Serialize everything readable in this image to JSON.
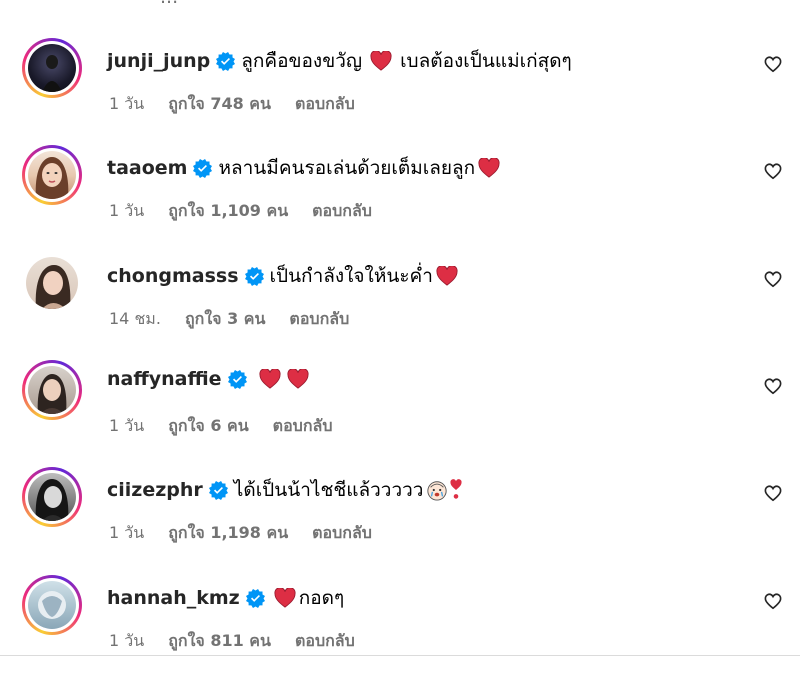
{
  "cut_off_text": "...",
  "comments": [
    {
      "username": "junji_junp",
      "text": "ลูกคือของขวัญ",
      "suffix": "เบลต้องเป็นแม่เก่สุดๆ",
      "time": "1 วัน",
      "likes": "ถูกใจ 748 คน",
      "reply": "ตอบกลับ",
      "ring": true
    },
    {
      "username": "taaoem",
      "text": "หลานมีคนรอเล่นด้วยเต็มเลยลูก",
      "suffix": "",
      "time": "1 วัน",
      "likes": "ถูกใจ 1,109 คน",
      "reply": "ตอบกลับ",
      "ring": true
    },
    {
      "username": "chongmasss",
      "text": "เป็นกำลังใจให้นะค่ำ",
      "suffix": "",
      "time": "14 ชม.",
      "likes": "ถูกใจ 3 คน",
      "reply": "ตอบกลับ",
      "ring": false
    },
    {
      "username": "naffynaffie",
      "text": "",
      "suffix": "",
      "time": "1 วัน",
      "likes": "ถูกใจ 6 คน",
      "reply": "ตอบกลับ",
      "ring": true
    },
    {
      "username": "ciizezphr",
      "text": "ได้เป็นน้าไชชีแล้ววววว",
      "suffix": "",
      "time": "1 วัน",
      "likes": "ถูกใจ 1,198 คน",
      "reply": "ตอบกลับ",
      "ring": true
    },
    {
      "username": "hannah_kmz",
      "text": "กอดๆ",
      "suffix": "",
      "time": "1 วัน",
      "likes": "ถูกใจ 811 คน",
      "reply": "ตอบกลับ",
      "ring": true
    }
  ],
  "colors": {
    "verified": "#0095f6",
    "heart": "#e0245e",
    "muted": "#737373"
  },
  "icons": {
    "verified": "verified-badge-icon",
    "like": "heart-outline-icon"
  }
}
